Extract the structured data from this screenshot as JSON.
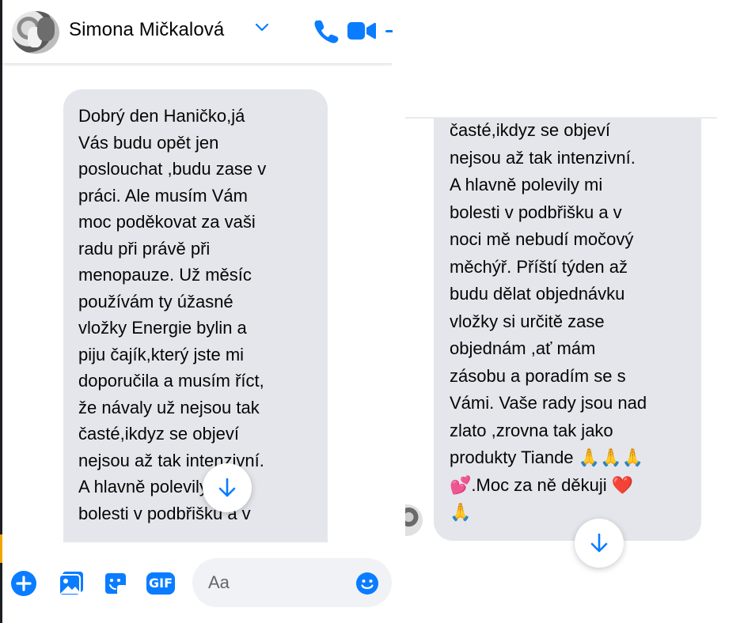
{
  "left": {
    "contact_name": "Simona Mičkalová",
    "message": "Dobrý den Haničko,já\nVás budu opět jen\nposlouchat ,budu zase v\npráci. Ale musím Vám\nmoc poděkovat za vaši\nradu při právě při\nmenopauze. Už měsíc\npoužívám ty úžasné\nvložky Energie bylin a\npiju čajík,který jste mi\ndoporučila a musím říct,\nže návaly už nejsou tak\nčasté,ikdyz se objeví\nnejsou až tak intenzivní.\nA hlavně polevily mi\nbolesti v podbřišku a v",
    "composer_placeholder": "Aa",
    "icons": [
      "avatar",
      "chevron-down-icon",
      "phone-icon",
      "video-icon",
      "scroll-down-icon",
      "plus-icon",
      "photo-icon",
      "sticker-icon",
      "gif-icon",
      "emoji-icon"
    ],
    "gif_label": "GIF"
  },
  "right": {
    "message": "časté,ikdyz se objeví\nnejsou až tak intenzivní.\nA hlavně polevily mi\nbolesti v podbřišku a v\nnoci mě nebudí močový\nměchýř. Příští týden až\nbudu dělat objednávku\nvložky si určitě zase\nobjednám ,ať mám\nzásobu a poradím se s\nVámi. Vaše rady jsou nad\nzlato ,zrovna tak jako\nprodukty Tiande 🙏🙏🙏\n💕.Moc za ně děkuji ❤️\n🙏"
  },
  "colors": {
    "accent": "#0a7cff",
    "bubble": "#e4e6eb",
    "text": "#050505"
  }
}
